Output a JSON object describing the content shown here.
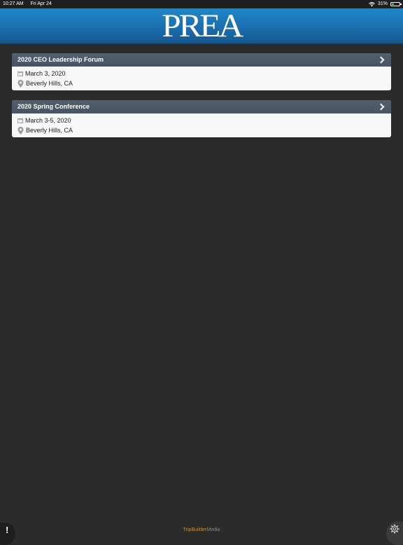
{
  "status_bar": {
    "time": "10:27 AM",
    "date": "Fri Apr 24",
    "battery": "31%",
    "battery_level": 0.31
  },
  "header": {
    "logo_text": "PREA"
  },
  "events": [
    {
      "title": "2020 CEO Leadership Forum",
      "date": "March 3, 2020",
      "location": "Beverly Hills, CA"
    },
    {
      "title": "2020 Spring Conference",
      "date": "March 3-5, 2020",
      "location": "Beverly Hills, CA"
    }
  ],
  "footer": {
    "brand_part1": "TripBuilder",
    "brand_part2": "Media"
  },
  "icons": {
    "alert": "alert-icon",
    "settings": "gear-icon"
  },
  "colors": {
    "header": "#1b6fae",
    "background": "#2b2b2b",
    "card_header": "#4b5967",
    "brand_orange": "#e08a17"
  }
}
